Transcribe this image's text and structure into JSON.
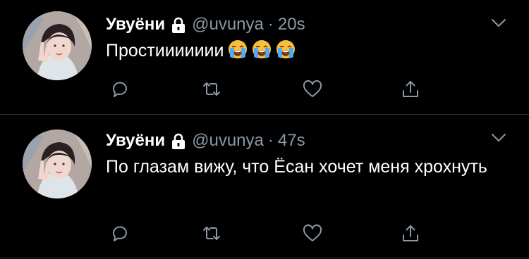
{
  "colors": {
    "background": "#000000",
    "primary_text": "#ffffff",
    "secondary_text": "#8b98a5",
    "divider": "#2f3336",
    "icon": "#8b98a5"
  },
  "tweets": [
    {
      "display_name": "Увуёни",
      "protected": true,
      "handle": "@uvunya",
      "separator": "·",
      "time": "20s",
      "text": "Простиииииии",
      "emojis": [
        "loudly-crying-face",
        "loudly-crying-face",
        "loudly-crying-face"
      ],
      "icons": [
        "reply-icon",
        "retweet-icon",
        "like-icon",
        "share-icon",
        "chevron-down-icon"
      ]
    },
    {
      "display_name": "Увуёни",
      "protected": true,
      "handle": "@uvunya",
      "separator": "·",
      "time": "47s",
      "text": "По глазам вижу, что Ёсан хочет меня хрохнуть",
      "icons": [
        "reply-icon",
        "retweet-icon",
        "like-icon",
        "share-icon",
        "chevron-down-icon"
      ]
    }
  ]
}
